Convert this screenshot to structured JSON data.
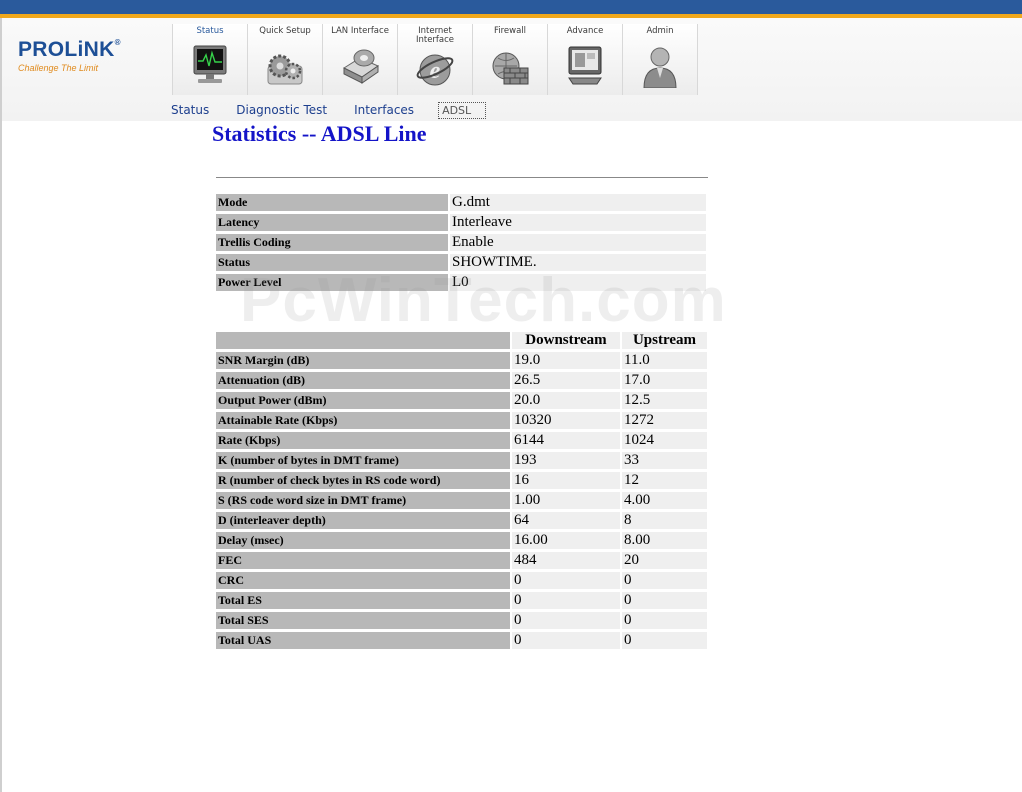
{
  "brand": {
    "name": "PROLiNK",
    "reg": "®",
    "slogan": "Challenge The Limit"
  },
  "tabs": [
    {
      "label": "Status",
      "icon": "monitor-icon"
    },
    {
      "label": "Quick Setup",
      "icon": "gears-icon"
    },
    {
      "label": "LAN Interface",
      "icon": "lan-drive-icon"
    },
    {
      "label": "Internet Interface",
      "icon": "internet-explorer-icon"
    },
    {
      "label": "Firewall",
      "icon": "firewall-globe-icon"
    },
    {
      "label": "Advance",
      "icon": "advanced-monitor-icon"
    },
    {
      "label": "Admin",
      "icon": "admin-user-icon"
    }
  ],
  "active_tab": "Status",
  "subnav": [
    "Status",
    "Diagnostic Test",
    "Interfaces",
    "ADSL"
  ],
  "active_subnav": "ADSL",
  "page_title": "Statistics -- ADSL Line",
  "watermark": "PcWinTech.com",
  "info": [
    {
      "label": "Mode",
      "value": "G.dmt"
    },
    {
      "label": "Latency",
      "value": "Interleave"
    },
    {
      "label": "Trellis Coding",
      "value": "Enable"
    },
    {
      "label": "Status",
      "value": "SHOWTIME."
    },
    {
      "label": "Power Level",
      "value": "L0"
    }
  ],
  "stats": {
    "headers": [
      "",
      "Downstream",
      "Upstream"
    ],
    "rows": [
      {
        "label": "SNR Margin (dB)",
        "down": "19.0",
        "up": "11.0"
      },
      {
        "label": "Attenuation (dB)",
        "down": "26.5",
        "up": "17.0"
      },
      {
        "label": "Output Power (dBm)",
        "down": "20.0",
        "up": "12.5"
      },
      {
        "label": "Attainable Rate (Kbps)",
        "down": "10320",
        "up": "1272"
      },
      {
        "label": "Rate (Kbps)",
        "down": "6144",
        "up": "1024"
      },
      {
        "label": "K (number of bytes in DMT frame)",
        "down": "193",
        "up": "33"
      },
      {
        "label": "R (number of check bytes in RS code word)",
        "down": "16",
        "up": "12"
      },
      {
        "label": "S (RS code word size in DMT frame)",
        "down": "1.00",
        "up": "4.00"
      },
      {
        "label": "D (interleaver depth)",
        "down": "64",
        "up": "8"
      },
      {
        "label": "Delay (msec)",
        "down": "16.00",
        "up": "8.00"
      },
      {
        "label": "FEC",
        "down": "484",
        "up": "20"
      },
      {
        "label": "CRC",
        "down": "0",
        "up": "0"
      },
      {
        "label": "Total ES",
        "down": "0",
        "up": "0"
      },
      {
        "label": "Total SES",
        "down": "0",
        "up": "0"
      },
      {
        "label": "Total UAS",
        "down": "0",
        "up": "0"
      }
    ]
  },
  "colors": {
    "topbar": "#2a5a9c",
    "accent_stripe": "#f0a81c",
    "title": "#1414c8",
    "label_cell": "#b8b8b8",
    "value_cell": "#efefef",
    "subnav_link": "#1d3f8e"
  }
}
